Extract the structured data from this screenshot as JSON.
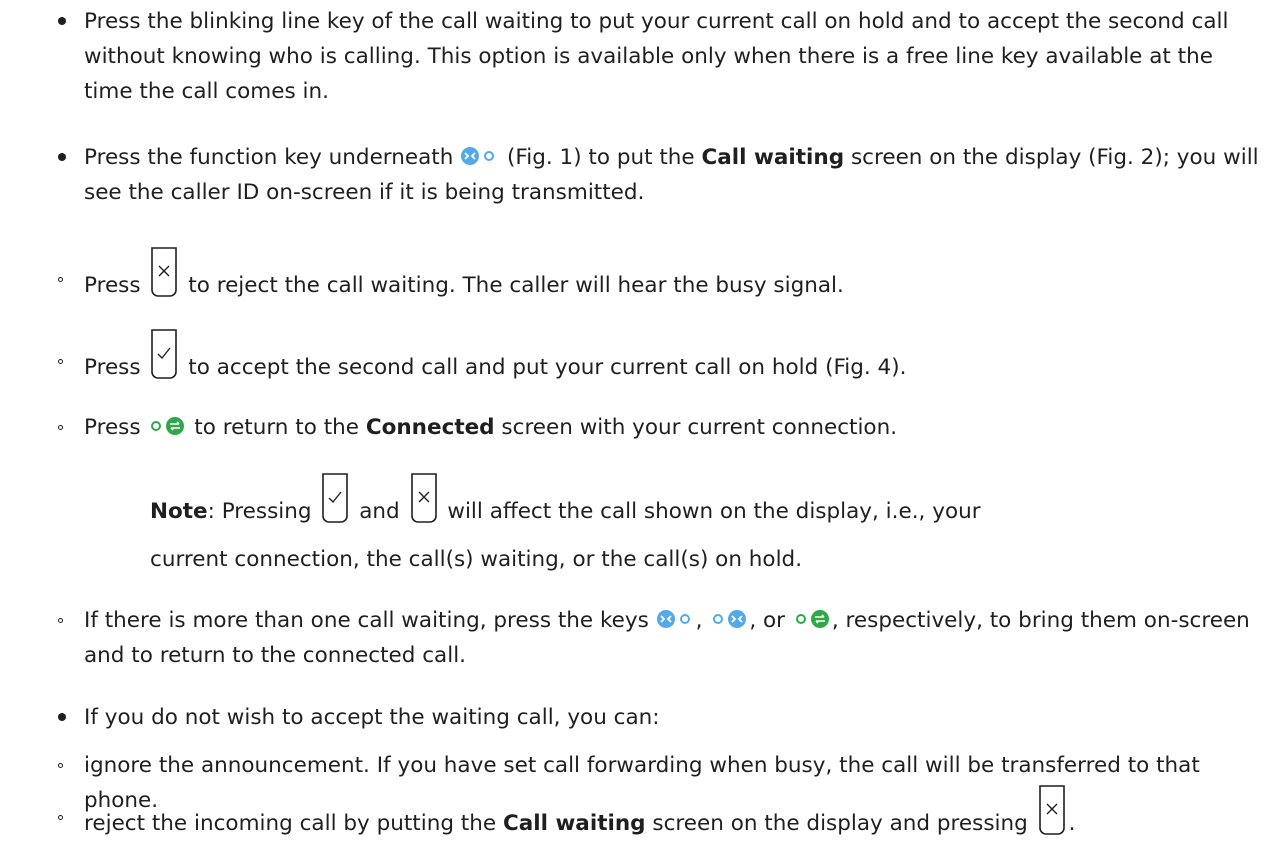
{
  "colors": {
    "text": "#1f1f1f",
    "nav_green": "#2ea84a",
    "nav_blue": "#55a9e6",
    "nav_dot": "#8a8a8a"
  },
  "icons": {
    "reject_key": "x-key-icon",
    "accept_key": "check-key-icon",
    "call_waiting_nav": "call-waiting-nav-icon",
    "connected_nav": "connected-nav-icon"
  },
  "p1": "Press the blinking line key of the call waiting to put your current call on hold and to accept the second call without knowing who is calling.  This option is available only when there is a free line key available at the time the call comes in.",
  "p2": {
    "a": "Press the function key underneath",
    "b": "(Fig. 1) to put the",
    "bold": "Call waiting",
    "c": "screen on the display (Fig. 2); you will see the caller ID on-screen if it is being transmitted."
  },
  "s1": {
    "a": "Press",
    "b": "to reject the call waiting.  The caller will hear the busy signal."
  },
  "s2": {
    "a": "Press",
    "b": "to accept the second call and put your current call on hold (Fig. 4)."
  },
  "s3": {
    "a": "Press",
    "b": "to return to the",
    "bold": "Connected",
    "c": "screen with your current connection."
  },
  "note": {
    "label": "Note",
    "a": ":  Pressing",
    "and": "and",
    "b": "will affect the call shown on the display, i.e., your",
    "c": "current connection, the call(s) waiting, or the call(s) on hold."
  },
  "s4": {
    "a": "If there is more than one call waiting, press the keys",
    "sep1": ",",
    "sep2": ", or",
    "b": ", respectively, to bring them on-screen and to return to the connected call."
  },
  "p3": "If you do not wish to accept the waiting call, you can:",
  "s5": "ignore the announcement.  If you have set call forwarding when busy, the call will be transferred to that phone.",
  "s6": {
    "a": "reject the incoming call by putting the",
    "bold": "Call waiting",
    "b": "screen on the display and pressing",
    "end": "."
  }
}
